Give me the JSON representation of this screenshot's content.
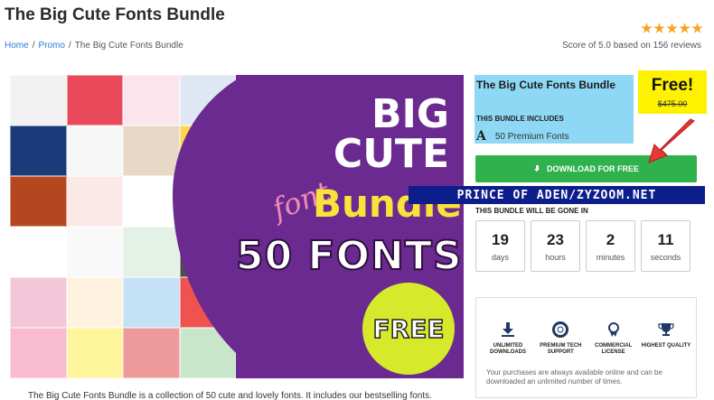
{
  "page": {
    "title": "The Big Cute Fonts Bundle",
    "rating_stars": 5
  },
  "breadcrumb": {
    "home": "Home",
    "promo": "Promo",
    "current": "The Big Cute Fonts Bundle"
  },
  "score_text": "Score of 5.0 based on 156 reviews",
  "hero": {
    "line1": "BIG",
    "line2": "CUTE",
    "font_word": "font",
    "bundle_word": "Bundle",
    "count_text": "50 FONTS",
    "badge": "FREE",
    "colors": {
      "background": "#6b2a8f",
      "accent_yellow": "#f9e23a",
      "accent_pink": "#f38bb5",
      "badge": "#d6ea2b"
    },
    "tile_colors": [
      "#f2f2f2",
      "#e94a5b",
      "#fce4ec",
      "#dfe7f5",
      "#1b3a7a",
      "#f7f7f7",
      "#e8d9c7",
      "#ffd54f",
      "#b5461f",
      "#fbe9e7",
      "#ffffff",
      "#2b6fb3",
      "#ffffff",
      "#f9f9f9",
      "#e3f1e6",
      "#4d4d4d",
      "#f3c7d8",
      "#fff3e0",
      "#c5e1f5",
      "#ef5350",
      "#f8bbd0",
      "#fff59d",
      "#ef9a9a",
      "#c8e6c9"
    ]
  },
  "bundle_info": {
    "title": "The Big Cute Fonts Bundle",
    "includes_label": "THIS BUNDLE INCLUDES",
    "includes_icon": "A",
    "includes_text": "50 Premium Fonts"
  },
  "price": {
    "free_label": "Free!",
    "old_price": "$475.00"
  },
  "download_button": {
    "label": "DOWNLOAD FOR FREE",
    "icon": "download-icon",
    "color": "#2fb14b"
  },
  "watermark": "PRINCE OF ADEN/ZYZOOM.NET",
  "countdown": {
    "label": "THIS BUNDLE WILL BE GONE IN",
    "units": [
      {
        "value": "19",
        "label": "days"
      },
      {
        "value": "23",
        "label": "hours"
      },
      {
        "value": "2",
        "label": "minutes"
      },
      {
        "value": "11",
        "label": "seconds"
      }
    ]
  },
  "features": {
    "items": [
      {
        "icon": "download-icon",
        "label": "UNLIMITED DOWNLOADS"
      },
      {
        "icon": "lifebuoy-icon",
        "label": "PREMIUM TECH SUPPORT"
      },
      {
        "icon": "award-icon",
        "label": "COMMERCIAL LICENSE"
      },
      {
        "icon": "trophy-icon",
        "label": "HIGHEST QUALITY"
      }
    ],
    "note": "Your purchases are always available online and can be downloaded an unlimited number of times."
  },
  "description": "The Big Cute Fonts Bundle is a collection of 50 cute and lovely fonts. It includes our bestselling fonts."
}
